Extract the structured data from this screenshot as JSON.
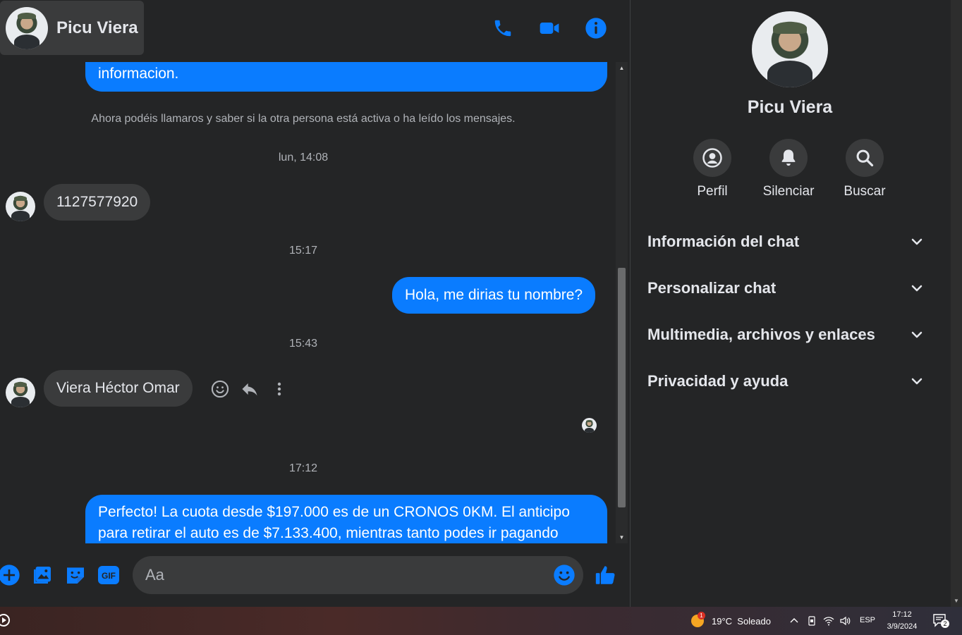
{
  "header": {
    "contact_name": "Picu Viera"
  },
  "messages": {
    "partial_top_text": "informacion.",
    "system_note": "Ahora podéis llamaros y saber si la otra persona está activa o ha leído los mensajes.",
    "time1": "lun, 14:08",
    "in1": "1127577920",
    "time2": "15:17",
    "out1": "Hola, me dirias tu nombre?",
    "time3": "15:43",
    "in2": "Viera Héctor Omar",
    "time4": "17:12",
    "out2": "Perfecto! La cuota desde $197.000 es de un CRONOS 0KM. El anticipo para retirar el auto es de $7.133.400, mientras tanto podes ir pagando"
  },
  "composer": {
    "placeholder": "Aa"
  },
  "right_panel": {
    "name": "Picu Viera",
    "actions": [
      {
        "label": "Perfil",
        "icon": "profile-icon"
      },
      {
        "label": "Silenciar",
        "icon": "bell-icon"
      },
      {
        "label": "Buscar",
        "icon": "search-icon"
      }
    ],
    "sections": [
      "Información del chat",
      "Personalizar chat",
      "Multimedia, archivos y enlaces",
      "Privacidad y ayuda"
    ]
  },
  "taskbar": {
    "weather": "19°C  Soleado",
    "language": "ESP",
    "time": "17:12",
    "date": "3/9/2024",
    "notification_count": "2",
    "weather_badge": "1"
  },
  "colors": {
    "accent": "#0a7cff",
    "background": "#242526",
    "bubble_incoming": "#3a3b3c"
  }
}
